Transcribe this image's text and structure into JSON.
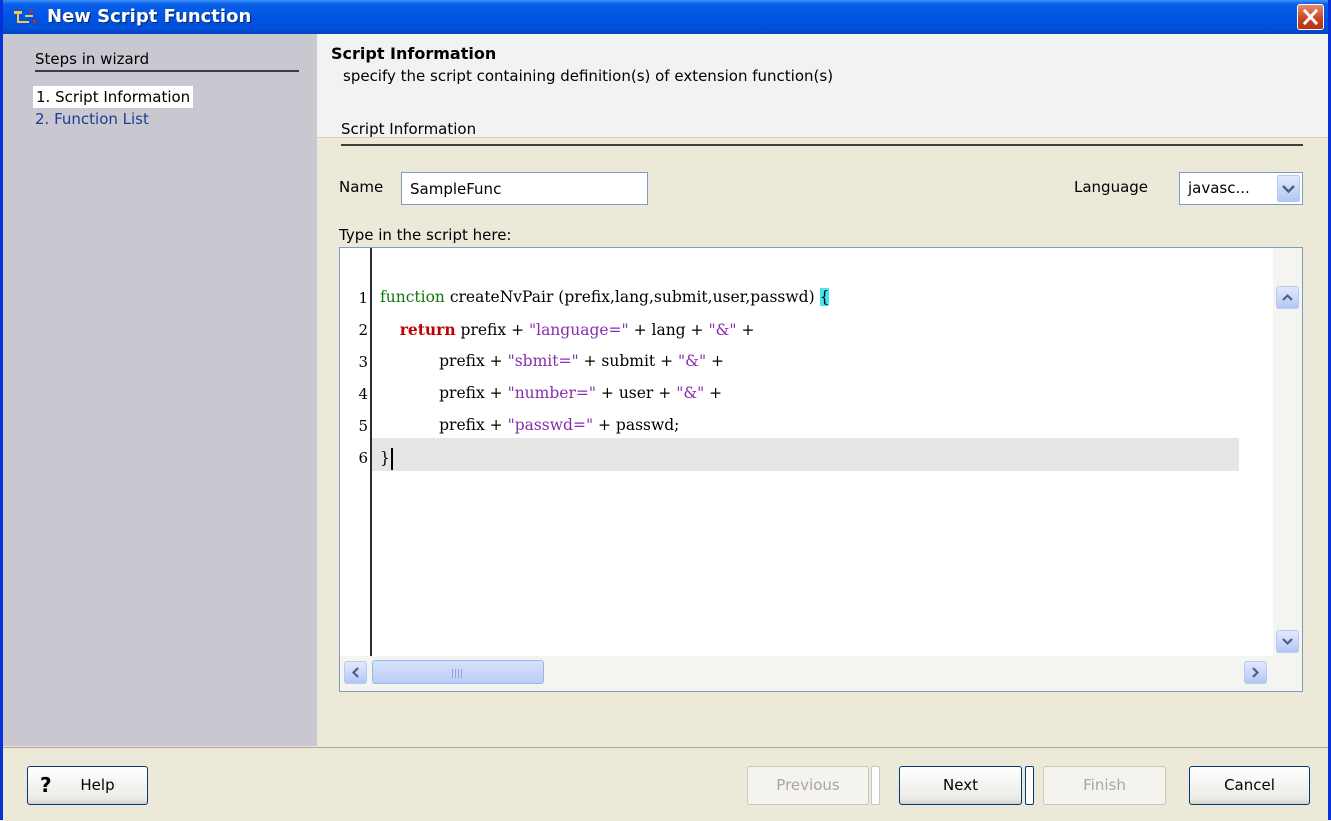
{
  "window": {
    "title": "New Script Function"
  },
  "steps": {
    "heading": "Steps in wizard",
    "items": [
      "1. Script Information",
      "2. Function List"
    ]
  },
  "header": {
    "title": "Script Information",
    "subtitle": "specify the script containing definition(s) of extension function(s)"
  },
  "panel": {
    "title": "Script Information"
  },
  "form": {
    "name_label": "Name",
    "name_value": "SampleFunc",
    "language_label": "Language",
    "language_value": "javasc...",
    "script_label": "Type in the script here:"
  },
  "editor": {
    "line_numbers": [
      "1",
      "2",
      "3",
      "4",
      "5",
      "6"
    ],
    "lines": [
      [
        "function",
        " createNvPair (prefix,lang,submit,user,passwd) ",
        "{"
      ],
      [
        "    ",
        "return",
        " prefix + ",
        "\"language=\"",
        " + lang + ",
        "\"&\"",
        " +"
      ],
      [
        "            prefix + ",
        "\"sbmit=\"",
        " + submit + ",
        "\"&\"",
        " +"
      ],
      [
        "            prefix + ",
        "\"number=\"",
        " + user + ",
        "\"&\"",
        " +"
      ],
      [
        "            prefix + ",
        "\"passwd=\"",
        " + passwd;"
      ],
      [
        "}"
      ]
    ],
    "current_line": 6
  },
  "buttons": {
    "help": "Help",
    "previous": "Previous",
    "next": "Next",
    "finish": "Finish",
    "cancel": "Cancel"
  },
  "colors": {
    "title_bar": "#0054E3",
    "keyword": "#0B7A0B",
    "return_keyword": "#C00000",
    "string": "#8B2CB0",
    "brace_highlight": "#44E6F0",
    "current_line": "#E6E6E6"
  },
  "icons": [
    "app-icon",
    "close-icon",
    "help-icon",
    "scroll-up-icon",
    "scroll-down-icon",
    "scroll-left-icon",
    "scroll-right-icon",
    "dropdown-arrow-icon"
  ]
}
